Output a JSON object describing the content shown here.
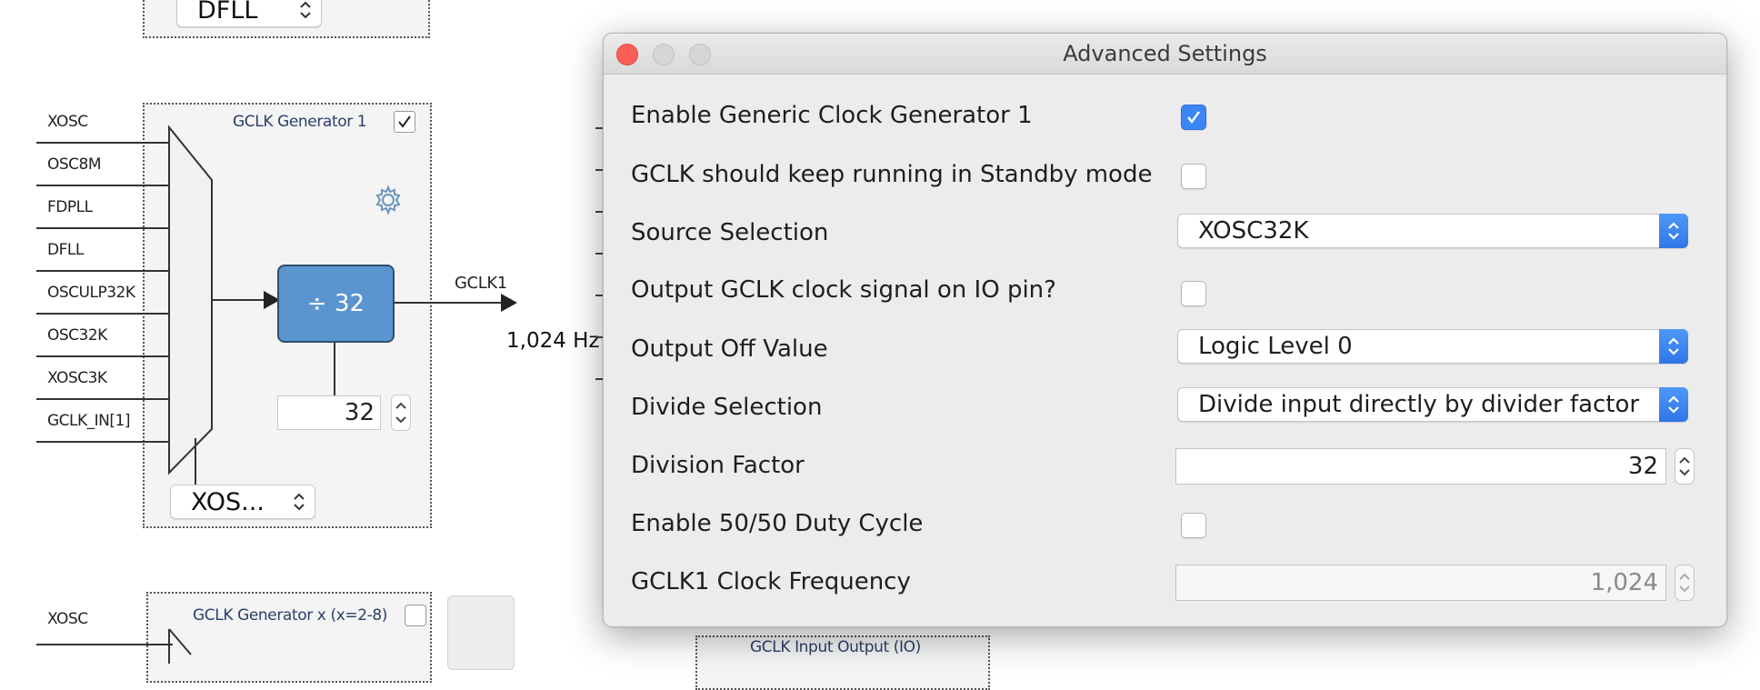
{
  "canvas": {
    "top_select_value": "DFLL",
    "generator1": {
      "title": "GCLK Generator 1",
      "inputs": [
        "XOSC",
        "OSC8M",
        "FDPLL",
        "DFLL",
        "OSCULP32K",
        "OSC32K",
        "XOSC3K",
        "GCLK_IN[1]"
      ],
      "divider_label": "÷ 32",
      "divider_value": "32",
      "source_select": "XOS...",
      "output_label": "GCLK1",
      "output_freq": "1,024 Hz",
      "enabled": true
    },
    "generator_x": {
      "title": "GCLK Generator x (x=2-8)",
      "input_label": "XOSC",
      "enabled": false
    },
    "io_box_title": "GCLK Input Output (IO)"
  },
  "dialog": {
    "title": "Advanced Settings",
    "rows": {
      "enable_gen": {
        "label": "Enable Generic Clock Generator 1",
        "checked": true
      },
      "standby": {
        "label": "GCLK should keep running in Standby mode",
        "checked": false
      },
      "source": {
        "label": "Source Selection",
        "value": "XOSC32K"
      },
      "output_io": {
        "label": "Output GCLK clock signal on IO pin?",
        "checked": false
      },
      "output_off": {
        "label": "Output Off Value",
        "value": "Logic Level 0"
      },
      "divide_sel": {
        "label": "Divide Selection",
        "value": "Divide input directly by divider factor"
      },
      "division_factor": {
        "label": "Division Factor",
        "value": "32"
      },
      "duty_cycle": {
        "label": "Enable 50/50 Duty Cycle",
        "checked": false
      },
      "frequency": {
        "label": "GCLK1 Clock Frequency",
        "value": "1,024"
      }
    }
  },
  "colors": {
    "accent": "#3b86f7",
    "divider_block": "#5b95d0",
    "close_button": "#fc5f57"
  },
  "icons": [
    "checkmark-icon",
    "gear-icon",
    "chevron-updown-icon",
    "stepper-icon",
    "arrow-right-icon"
  ]
}
